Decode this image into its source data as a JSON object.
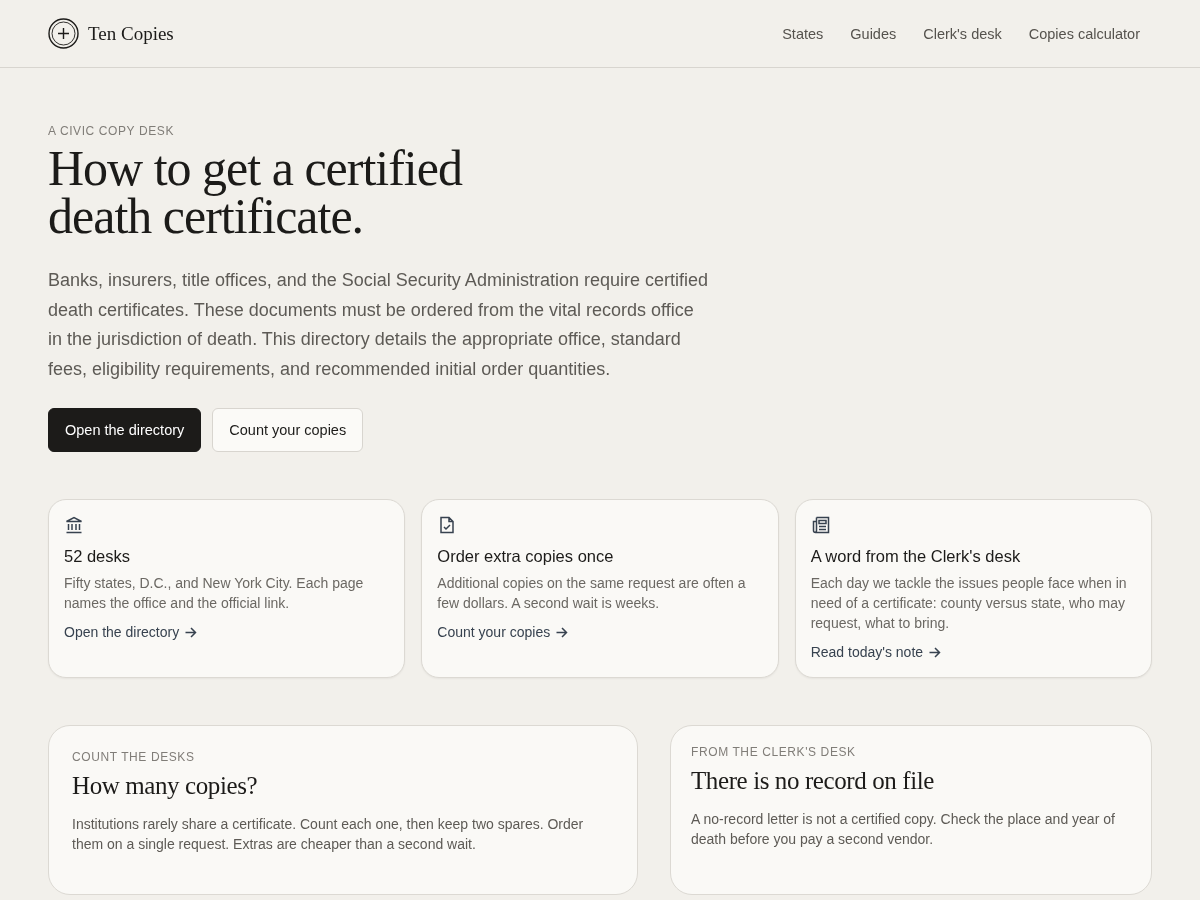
{
  "brand": {
    "name": "Ten Copies"
  },
  "nav": [
    {
      "label": "States"
    },
    {
      "label": "Guides"
    },
    {
      "label": "Clerk's desk"
    },
    {
      "label": "Copies calculator"
    }
  ],
  "hero": {
    "eyebrow": "A CIVIC COPY DESK",
    "title_lines": [
      "How to get a certified",
      "death certificate."
    ],
    "lead": "Banks, insurers, title offices, and the Social Security Administration require certified death certificates. These documents must be ordered from the vital records office in the jurisdiction of death. This directory details the appropriate office, standard fees, eligibility requirements, and recommended initial order quantities.",
    "buttons": [
      {
        "label": "Open the directory",
        "kind": "primary"
      },
      {
        "label": "Count your copies",
        "kind": "secondary"
      }
    ]
  },
  "features": [
    {
      "title": "52 desks",
      "text": "Fifty states, D.C., and New York City. Each page names the office and the official link.",
      "link": "Open the directory"
    },
    {
      "title": "Order extra copies once",
      "text": "Additional copies on the same request are often a few dollars. A second wait is weeks.",
      "link": "Count your copies"
    },
    {
      "title": "A word from the Clerk's desk",
      "text": "Each day we tackle the issues people face when in need of a certificate: county versus state, who may request, what to bring.",
      "link": "Read today's note"
    }
  ],
  "panels": [
    {
      "eyebrow": "COUNT THE DESKS",
      "title": "How many copies?",
      "text": "Institutions rarely share a certificate. Count each one, then keep two spares. Order them on a single request. Extras are cheaper than a second wait."
    },
    {
      "eyebrow": "FROM THE CLERK'S DESK",
      "title": "There is no record on file",
      "text": "A no-record letter is not a certified copy. Check the place and year of death before you pay a second vendor."
    }
  ]
}
